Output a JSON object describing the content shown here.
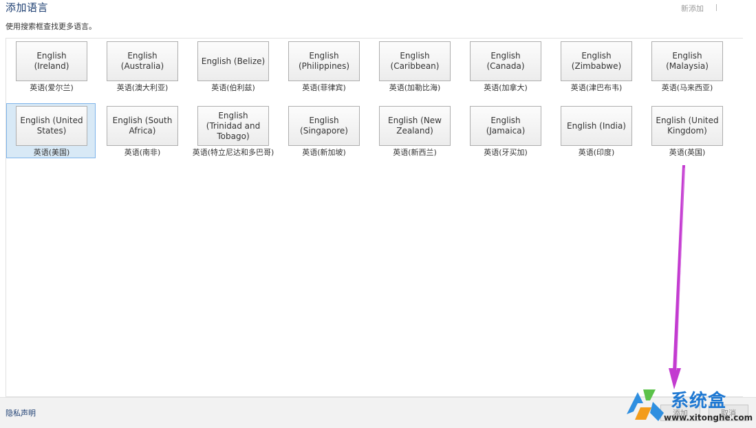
{
  "title": "添加语言",
  "topright_text": "新添加",
  "subtitle": "使用搜索框查找更多语言。",
  "languages": [
    {
      "btn": "English (Ireland)",
      "cap": "英语(爱尔兰)"
    },
    {
      "btn": "English (Australia)",
      "cap": "英语(澳大利亚)"
    },
    {
      "btn": "English (Belize)",
      "cap": "英语(伯利兹)"
    },
    {
      "btn": "English (Philippines)",
      "cap": "英语(菲律宾)"
    },
    {
      "btn": "English (Caribbean)",
      "cap": "英语(加勒比海)"
    },
    {
      "btn": "English (Canada)",
      "cap": "英语(加拿大)"
    },
    {
      "btn": "English (Zimbabwe)",
      "cap": "英语(津巴布韦)"
    },
    {
      "btn": "English (Malaysia)",
      "cap": "英语(马来西亚)"
    },
    {
      "btn": "English (United States)",
      "cap": "英语(美国)"
    },
    {
      "btn": "English (South Africa)",
      "cap": "英语(南非)"
    },
    {
      "btn": "English (Trinidad and Tobago)",
      "cap": "英语(特立尼达和多巴哥)"
    },
    {
      "btn": "English (Singapore)",
      "cap": "英语(新加坡)"
    },
    {
      "btn": "English (New Zealand)",
      "cap": "英语(新西兰)"
    },
    {
      "btn": "English (Jamaica)",
      "cap": "英语(牙买加)"
    },
    {
      "btn": "English (India)",
      "cap": "英语(印度)"
    },
    {
      "btn": "English (United Kingdom)",
      "cap": "英语(英国)"
    }
  ],
  "selected_language": "English (United States)",
  "footer": {
    "privacy_label": "隐私声明",
    "add_label": "添加",
    "cancel_label": "取消"
  },
  "watermark": {
    "name": "系统盒",
    "url": "www.xitonghe.com"
  },
  "annotation_color": "#c33bd0"
}
